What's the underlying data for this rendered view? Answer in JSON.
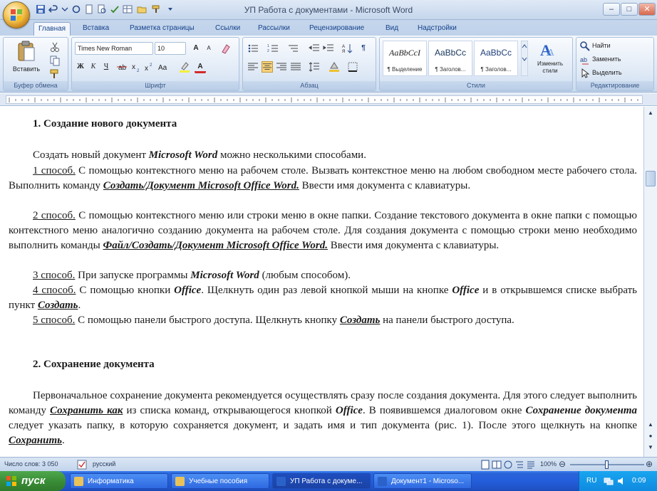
{
  "window": {
    "title": "УП Работа с документами - Microsoft Word"
  },
  "ribbon_tabs": [
    {
      "label": "Главная",
      "active": true
    },
    {
      "label": "Вставка"
    },
    {
      "label": "Разметка страницы"
    },
    {
      "label": "Ссылки"
    },
    {
      "label": "Рассылки"
    },
    {
      "label": "Рецензирование"
    },
    {
      "label": "Вид"
    },
    {
      "label": "Надстройки"
    }
  ],
  "ribbon": {
    "clipboard": {
      "label": "Буфер обмена",
      "paste": "Вставить"
    },
    "font": {
      "label": "Шрифт",
      "name": "Times New Roman",
      "size": "10",
      "bold": "Ж",
      "italic": "К",
      "underline": "Ч",
      "grow": "A",
      "shrink": "A",
      "color_letter": "A"
    },
    "paragraph": {
      "label": "Абзац",
      "pilcrow": "¶"
    },
    "styles": {
      "label": "Стили",
      "items": [
        {
          "sample": "AaBbCcI",
          "name": "¶ Выделение"
        },
        {
          "sample": "AaBbCc",
          "name": "¶ Заголов..."
        },
        {
          "sample": "AaBbCc",
          "name": "¶ Заголов..."
        }
      ],
      "change": "Изменить стили"
    },
    "editing": {
      "label": "Редактирование",
      "find": "Найти",
      "replace": "Заменить",
      "select": "Выделить"
    }
  },
  "document": {
    "sections": [
      {
        "heading": "1. Создание нового документа",
        "paragraphs": [
          {
            "runs": [
              {
                "t": "Создать новый документ "
              },
              {
                "t": "Microsoft Word",
                "bi": true
              },
              {
                "t": " можно несколькими способами."
              }
            ]
          },
          {
            "runs": [
              {
                "t": "1 способ.",
                "u": true
              },
              {
                "t": " С помощью контекстного меню на рабочем столе. Вызвать контекстное меню на любом свободном месте рабочего стола. Выполнить команду "
              },
              {
                "t": "Создать/Документ Microsoft Office Word.",
                "bi": true,
                "u": true
              },
              {
                "t": " Ввести имя документа с клавиатуры."
              }
            ]
          },
          {
            "runs": [
              {
                "t": "2 способ.",
                "u": true
              },
              {
                "t": " С помощью контекстного меню или строки меню в окне папки. Создание текстового документа в окне папки с помощью контекстного меню аналогично созданию документа на рабочем столе. Для создания документа с помощью строки меню необходимо выполнить команды "
              },
              {
                "t": "Файл/Создать/Документ Microsoft Office Word.",
                "bi": true,
                "u": true
              },
              {
                "t": " Ввести имя документа с клавиатуры."
              }
            ]
          },
          {
            "runs": [
              {
                "t": "3 способ.",
                "u": true
              },
              {
                "t": " При запуске программы "
              },
              {
                "t": "Microsoft Word",
                "bi": true
              },
              {
                "t": " (любым способом)."
              }
            ]
          },
          {
            "runs": [
              {
                "t": "4 способ.",
                "u": true
              },
              {
                "t": " С помощью кнопки "
              },
              {
                "t": "Office",
                "bi": true
              },
              {
                "t": ". Щелкнуть один раз левой кнопкой мыши на кнопке "
              },
              {
                "t": "Office",
                "bi": true
              },
              {
                "t": " и в открывшемся списке выбрать пункт "
              },
              {
                "t": "Создать",
                "bi": true,
                "u": true
              },
              {
                "t": "."
              }
            ]
          },
          {
            "runs": [
              {
                "t": "5 способ.",
                "u": true
              },
              {
                "t": " С помощью панели быстрого доступа. Щелкнуть кнопку "
              },
              {
                "t": "Создать",
                "bi": true,
                "u": true
              },
              {
                "t": " на панели быстрого доступа."
              }
            ]
          }
        ]
      },
      {
        "heading": "2. Сохранение документа",
        "paragraphs": [
          {
            "runs": [
              {
                "t": "Первоначальное сохранение документа рекомендуется осуществлять сразу после создания документа. Для этого следует выполнить команду "
              },
              {
                "t": "Сохранить как",
                "bi": true,
                "u": true
              },
              {
                "t": " из списка команд, открывающегося кнопкой "
              },
              {
                "t": "Office",
                "bi": true
              },
              {
                "t": ". В появившемся диалоговом окне "
              },
              {
                "t": "Сохранение документа",
                "bi": true
              },
              {
                "t": " следует указать папку, в которую сохраняется документ, и задать имя и тип документа (рис. 1). После этого щелкнуть на кнопке "
              },
              {
                "t": "Сохранить",
                "bi": true,
                "u": true
              },
              {
                "t": "."
              }
            ]
          }
        ]
      }
    ]
  },
  "status": {
    "words": "Число слов: 3 050",
    "language": "русский",
    "zoom": "100%"
  },
  "taskbar": {
    "start": "пуск",
    "tasks": [
      {
        "label": "Информатика",
        "icon_color": "#e9c25a"
      },
      {
        "label": "Учебные пособия",
        "icon_color": "#e9c25a"
      },
      {
        "label": "УП Работа с докуме...",
        "icon_color": "#2b62c9",
        "active": true
      },
      {
        "label": "Документ1 - Microso...",
        "icon_color": "#2b62c9"
      }
    ],
    "lang": "RU",
    "clock": "0:09"
  }
}
